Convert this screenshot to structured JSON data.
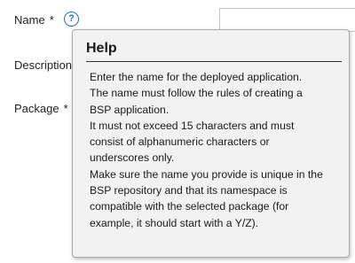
{
  "form": {
    "name_label": "Name",
    "description_label": "Description",
    "package_label": "Package",
    "required_marker": "*",
    "help_icon_glyph": "?"
  },
  "help": {
    "title": "Help",
    "lines": [
      "Enter the name for the deployed application.",
      "The name must follow the rules of creating a",
      "BSP application.",
      "It must not exceed 15 characters and must",
      "consist of alphanumeric characters or",
      "underscores only.",
      "Make sure the name you provide is unique in the",
      "BSP repository and that its namespace is",
      "compatible with the selected package (for",
      "example, it should start with a Y/Z)."
    ]
  },
  "colors": {
    "accent": "#2a6db5",
    "popover_bg": "#f2f2f2",
    "popover_border": "#a9a9a9",
    "text": "#1a1a1a"
  }
}
